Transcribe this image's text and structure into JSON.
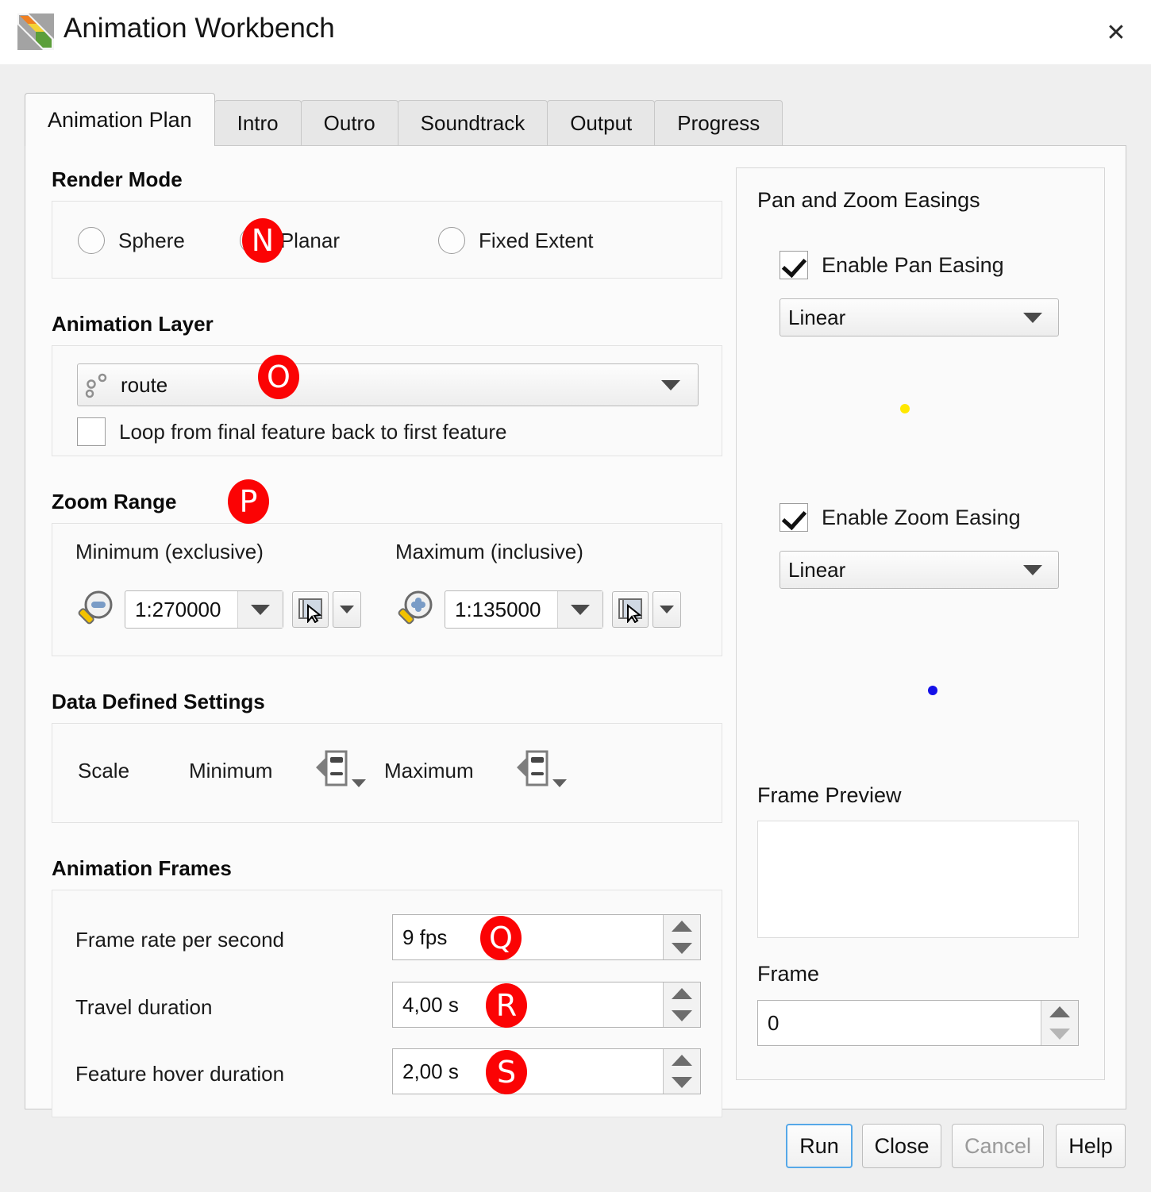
{
  "window": {
    "title": "Animation Workbench",
    "logo_icon": "qgis-diagonal-logo-icon",
    "close_icon": "close-icon"
  },
  "tabs": [
    {
      "label": "Animation Plan",
      "active": true
    },
    {
      "label": "Intro",
      "active": false
    },
    {
      "label": "Outro",
      "active": false
    },
    {
      "label": "Soundtrack",
      "active": false
    },
    {
      "label": "Output",
      "active": false
    },
    {
      "label": "Progress",
      "active": false
    }
  ],
  "render_mode": {
    "title": "Render Mode",
    "options": [
      {
        "label": "Sphere",
        "selected": false
      },
      {
        "label": "Planar",
        "selected": true
      },
      {
        "label": "Fixed Extent",
        "selected": false
      }
    ],
    "badge": "N"
  },
  "animation_layer": {
    "title": "Animation Layer",
    "layer_icon": "point-layer-icon",
    "selected_layer": "route",
    "badge": "O",
    "loop_checkbox": {
      "label": "Loop from final feature back to first feature",
      "checked": false
    }
  },
  "zoom_range": {
    "title": "Zoom Range",
    "badge": "P",
    "minimum": {
      "label": "Minimum (exclusive)",
      "icon": "zoom-out-magnifier-icon",
      "value": "1:270000",
      "map_button_icon": "set-to-map-canvas-scale-icon",
      "dropdown_icon": "chevron-down-icon"
    },
    "maximum": {
      "label": "Maximum (inclusive)",
      "icon": "zoom-in-magnifier-icon",
      "value": "1:135000",
      "map_button_icon": "set-to-map-canvas-scale-icon",
      "dropdown_icon": "chevron-down-icon"
    }
  },
  "data_defined": {
    "title": "Data Defined Settings",
    "scale_label": "Scale",
    "minimum_label": "Minimum",
    "maximum_label": "Maximum",
    "override_icon": "data-defined-override-icon"
  },
  "animation_frames": {
    "title": "Animation Frames",
    "rows": [
      {
        "label": "Frame rate per second",
        "value": "9 fps",
        "badge": "Q"
      },
      {
        "label": "Travel duration",
        "value": "4,00 s",
        "badge": "R"
      },
      {
        "label": "Feature hover duration",
        "value": "2,00 s",
        "badge": "S"
      }
    ]
  },
  "easings": {
    "title": "Pan and Zoom Easings",
    "pan": {
      "checkbox_label": "Enable Pan Easing",
      "checked": true,
      "easing_value": "Linear",
      "marker_color": "#ffe800"
    },
    "zoom": {
      "checkbox_label": "Enable Zoom Easing",
      "checked": true,
      "easing_value": "Linear",
      "marker_color": "#1410e8"
    }
  },
  "frame_preview": {
    "title": "Frame Preview",
    "frame_label": "Frame",
    "frame_value": "0"
  },
  "footer_buttons": [
    {
      "label": "Run",
      "state": "default"
    },
    {
      "label": "Close",
      "state": "normal"
    },
    {
      "label": "Cancel",
      "state": "disabled"
    },
    {
      "label": "Help",
      "state": "normal"
    }
  ],
  "colors": {
    "badge_red": "#fb0304",
    "default_button_border": "#56a8e8",
    "window_bg": "#efefef",
    "pane_bg": "#fbfbfb"
  }
}
